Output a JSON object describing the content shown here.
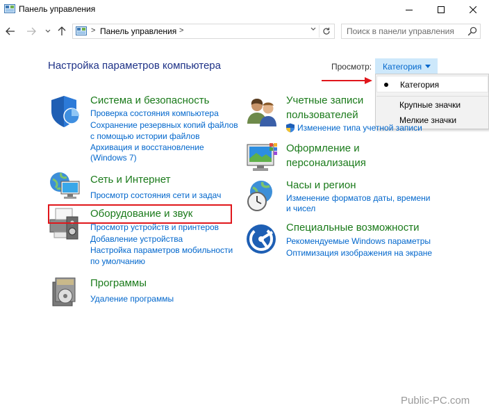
{
  "window": {
    "title": "Панель управления",
    "min_label": "",
    "colors": {
      "heading": "#1e3287",
      "category": "#1a7a1a",
      "link": "#0066cc",
      "annotation": "#e0161b"
    }
  },
  "address": {
    "separator": ">",
    "path": "Панель управления",
    "separator2": ">",
    "search_placeholder": "Поиск в панели управления"
  },
  "main": {
    "heading": "Настройка параметров компьютера",
    "view_label": "Просмотр:",
    "view_value": "Категория",
    "view_options": [
      "Категория",
      "Крупные значки",
      "Мелкие значки"
    ]
  },
  "categories": {
    "system": {
      "title": "Система и безопасность",
      "links": [
        "Проверка состояния компьютера",
        "Сохранение резервных копий файлов",
        "с помощью истории файлов",
        "Архивация и восстановление",
        "(Windows 7)"
      ]
    },
    "network": {
      "title": "Сеть и Интернет",
      "links": [
        "Просмотр состояния сети и задач"
      ]
    },
    "hardware": {
      "title": "Оборудование и звук",
      "links": [
        "Просмотр устройств и принтеров",
        "Добавление устройства",
        "Настройка параметров мобильности",
        "по умолчанию"
      ]
    },
    "programs": {
      "title": "Программы",
      "links": [
        "Удаление программы"
      ]
    },
    "users": {
      "title_line1": "Учетные записи",
      "title_line2": "пользователей",
      "links": [
        "Изменение типа учетной записи"
      ]
    },
    "appearance": {
      "title_line1": "Оформление и",
      "title_line2": "персонализация"
    },
    "clock": {
      "title": "Часы и регион",
      "links": [
        "Изменение форматов даты, времени",
        "и чисел"
      ]
    },
    "access": {
      "title": "Специальные возможности",
      "links": [
        "Рекомендуемые Windows параметры",
        "Оптимизация изображения на экране"
      ]
    }
  },
  "watermark": "Public-PC.com",
  "icons": [
    "control-panel-icon",
    "minimize-icon",
    "maximize-icon",
    "close-icon",
    "back-arrow-icon",
    "forward-arrow-icon",
    "recent-chevron-icon",
    "up-arrow-icon",
    "refresh-icon",
    "search-icon",
    "shield-icon",
    "network-icon",
    "printer-icon",
    "programs-icon",
    "users-icon",
    "appearance-icon",
    "clock-icon",
    "accessibility-icon"
  ]
}
